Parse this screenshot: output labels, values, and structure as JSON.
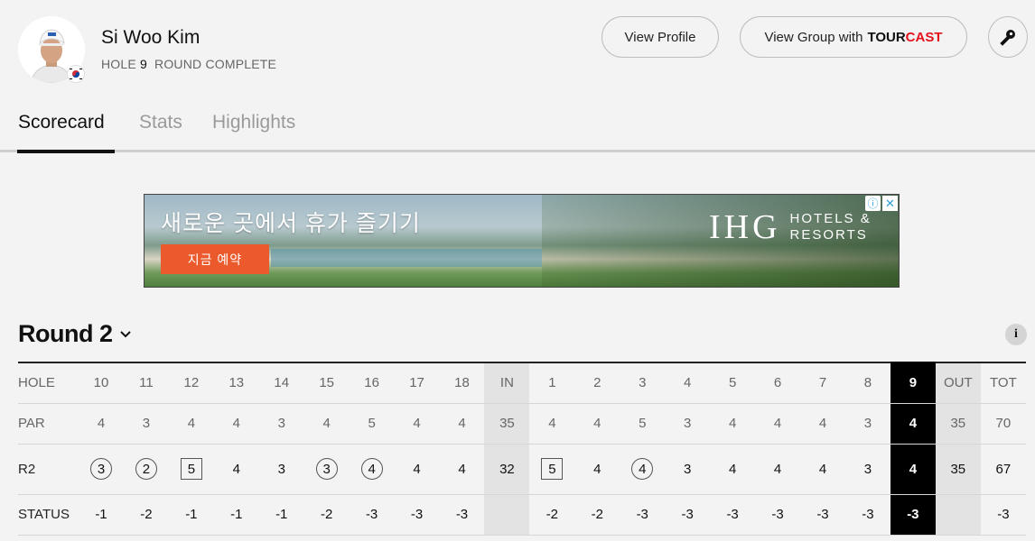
{
  "player": {
    "name": "Si Woo Kim",
    "hole_label": "HOLE",
    "hole_number": "9",
    "status": "ROUND COMPLETE"
  },
  "actions": {
    "view_profile": "View Profile",
    "view_group": "View Group with",
    "tourcast_1": "TOUR",
    "tourcast_2": "CAST"
  },
  "tabs": [
    {
      "label": "Scorecard",
      "active": true
    },
    {
      "label": "Stats",
      "active": false
    },
    {
      "label": "Highlights",
      "active": false
    }
  ],
  "ad": {
    "headline": "새로운 곳에서 휴가 즐기기",
    "cta": "지금 예약",
    "brand": "IHG",
    "brand_line1": "HOTELS &",
    "brand_line2": "RESORTS",
    "info_glyph": "ⓘ",
    "close_glyph": "✕"
  },
  "round": {
    "title": "Round 2",
    "chevron": "⌄",
    "info": "i"
  },
  "scorecard": {
    "rows": [
      {
        "label": "HOLE",
        "cells": [
          "10",
          "11",
          "12",
          "13",
          "14",
          "15",
          "16",
          "17",
          "18",
          "IN",
          "1",
          "2",
          "3",
          "4",
          "5",
          "6",
          "7",
          "8",
          "9",
          "OUT",
          "TOT"
        ]
      },
      {
        "label": "PAR",
        "cells": [
          "4",
          "3",
          "4",
          "4",
          "3",
          "4",
          "5",
          "4",
          "4",
          "35",
          "4",
          "4",
          "5",
          "3",
          "4",
          "4",
          "4",
          "3",
          "4",
          "35",
          "70"
        ]
      },
      {
        "label": "R2",
        "cells": [
          "3",
          "2",
          "5",
          "4",
          "3",
          "3",
          "4",
          "4",
          "4",
          "32",
          "5",
          "4",
          "4",
          "3",
          "4",
          "4",
          "4",
          "3",
          "4",
          "35",
          "67"
        ]
      },
      {
        "label": "STATUS",
        "cells": [
          "-1",
          "-2",
          "-1",
          "-1",
          "-1",
          "-2",
          "-3",
          "-3",
          "-3",
          "",
          "-2",
          "-2",
          "-3",
          "-3",
          "-3",
          "-3",
          "-3",
          "-3",
          "-3",
          "",
          "-3"
        ]
      }
    ],
    "score_marks": [
      "birdie",
      "birdie",
      "bogey",
      "",
      "",
      "birdie",
      "birdie",
      "",
      "",
      "",
      "bogey",
      "",
      "birdie",
      "",
      "",
      "",
      "",
      "",
      "",
      "",
      ""
    ],
    "total_columns": [
      9,
      19
    ],
    "current_column": 18
  },
  "colors": {
    "background": "#f3f3f3",
    "accent_red": "#e4111b",
    "ad_cta": "#ea5a2c",
    "current_hole_bg": "#000000"
  }
}
